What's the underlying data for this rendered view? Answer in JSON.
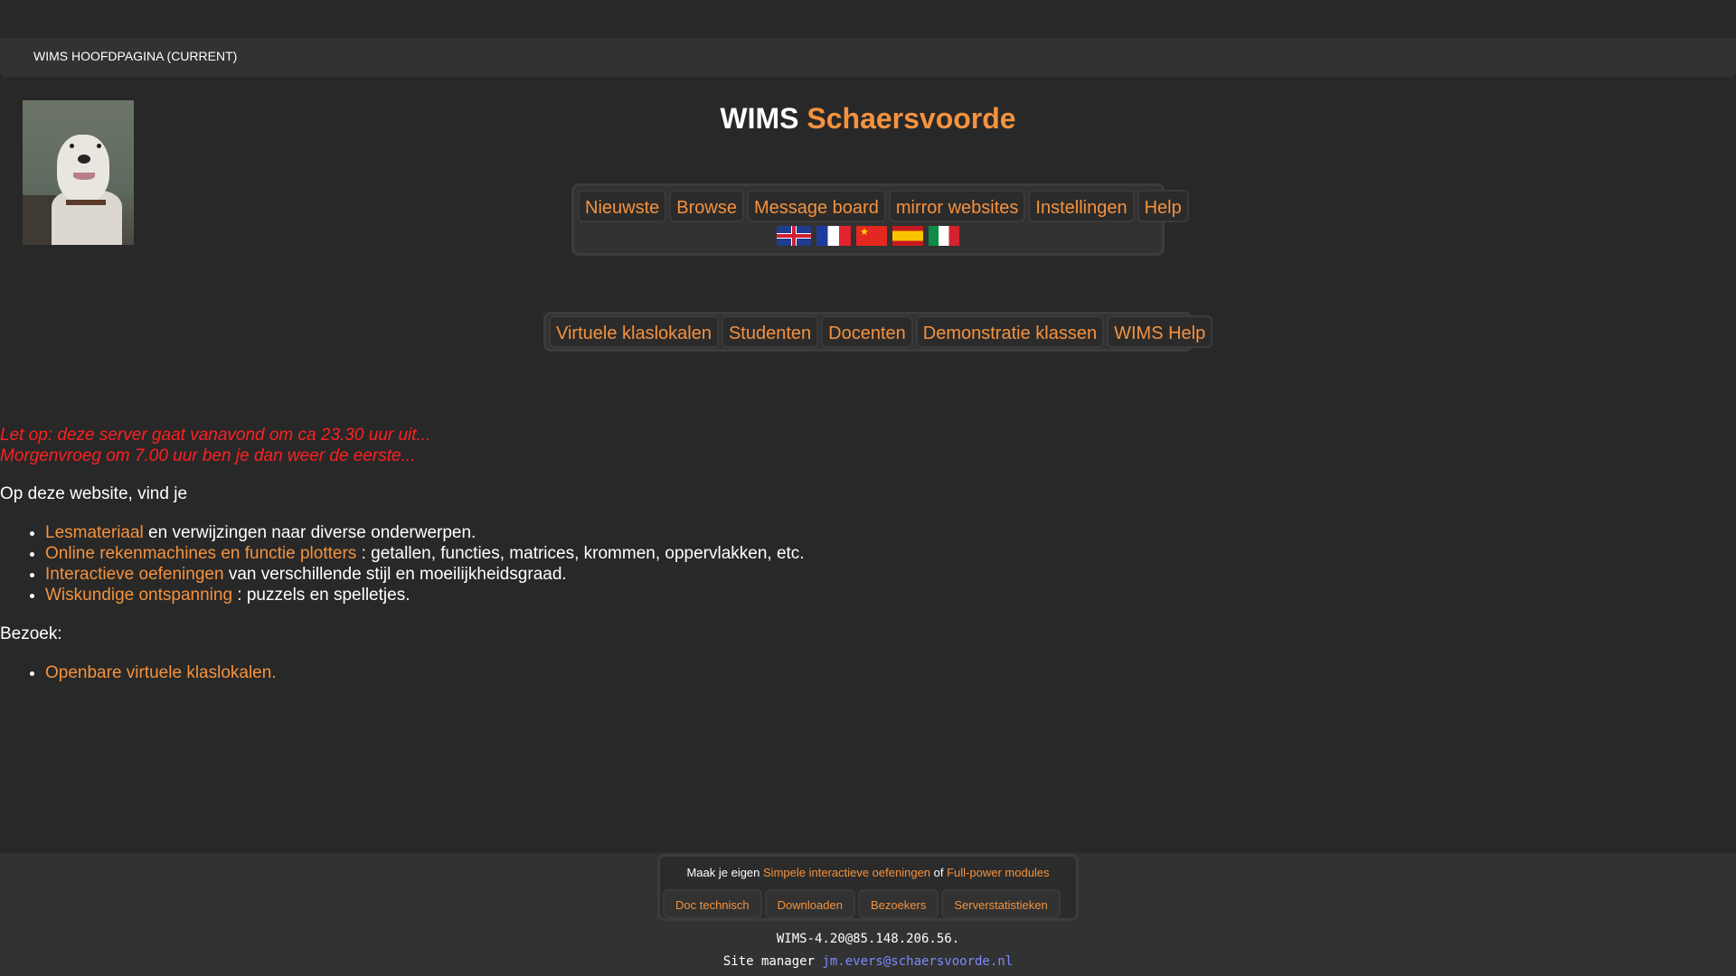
{
  "breadcrumb": "WIMS HOOFDPAGINA (CURRENT)",
  "title": {
    "part1": "WIMS",
    "part2": "Schaersvoorde"
  },
  "menu1": [
    "Nieuwste",
    "Browse",
    "Message board",
    "mirror websites",
    "Instellingen",
    "Help"
  ],
  "flags": [
    "uk-flag-icon",
    "france-flag-icon",
    "china-flag-icon",
    "spain-flag-icon",
    "italy-flag-icon"
  ],
  "menu2": [
    "Virtuele klaslokalen",
    "Studenten",
    "Docenten",
    "Demonstratie klassen",
    "WIMS Help"
  ],
  "notice": {
    "line1": "Let op: deze server gaat vanavond om ca 23.30 uur uit...",
    "line2": "Morgenvroeg om 7.00 uur ben je dan weer de eerste..."
  },
  "intro": "Op deze website, vind je",
  "features": [
    {
      "link": "Lesmateriaal",
      "text": " en verwijzingen naar diverse onderwerpen."
    },
    {
      "link": "Online rekenmachines en functie plotters",
      "text": " : getallen, functies, matrices, krommen, oppervlakken, etc."
    },
    {
      "link": "Interactieve oefeningen",
      "text": " van verschillende stijl en moeilijkheidsgraad."
    },
    {
      "link": "Wiskundige ontspanning",
      "text": " : puzzels en spelletjes."
    }
  ],
  "visit_label": "Bezoek:",
  "visit_links": [
    "Openbare virtuele klaslokalen."
  ],
  "footer": {
    "make_prefix": "Maak je eigen ",
    "make_link1": "Simpele interactieve oefeningen",
    "make_of": " of ",
    "make_link2": "Full-power modules",
    "links": [
      "Doc technisch",
      "Downloaden",
      "Bezoekers",
      "Serverstatistieken"
    ],
    "version": "WIMS-4.20@85.148.206.56.",
    "manager_label": "Site manager ",
    "manager_email": "jm.evers@schaersvoorde.nl"
  },
  "colors": {
    "accent": "#f5923e",
    "background": "#282828",
    "notice": "#ff2020",
    "email": "#7b8bff"
  }
}
